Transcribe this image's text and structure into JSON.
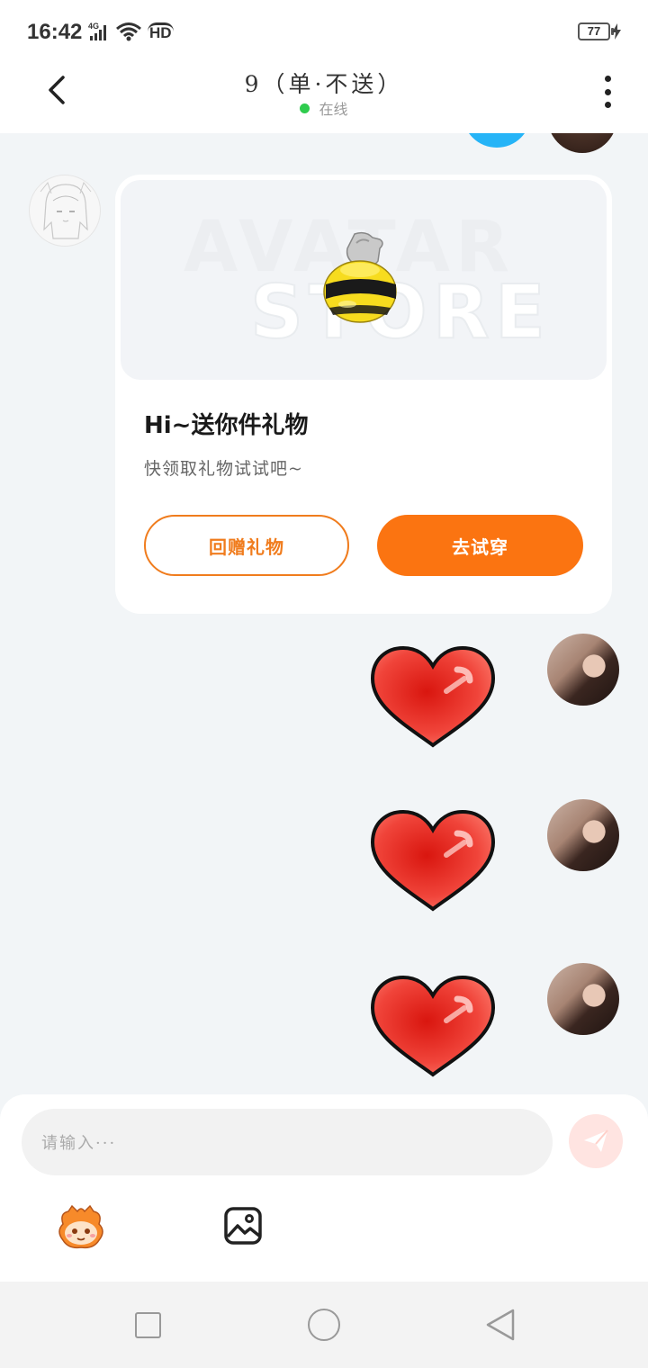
{
  "status_bar": {
    "time": "16:42",
    "network": "4G",
    "hd": "HD",
    "battery": "77",
    "icons": [
      "signal-icon",
      "wifi-icon",
      "hd-icon",
      "battery-icon",
      "charging-icon"
    ]
  },
  "header": {
    "title": "9（单·不送）",
    "status": "在线",
    "status_color": "#2fcc4e",
    "icons": [
      "back-arrow-icon",
      "more-options-icon"
    ]
  },
  "gift_card": {
    "watermark_line1": "AVATAR",
    "watermark_line2": "STORE",
    "title": "Hi~送你件礼物",
    "subtitle": "快领取礼物试试吧~",
    "return_gift_label": "回赠礼物",
    "try_on_label": "去试穿",
    "accent_color": "#fb7411"
  },
  "messages": [
    {
      "type": "sticker",
      "sticker": "red-heart",
      "sender": "me"
    },
    {
      "type": "sticker",
      "sticker": "red-heart",
      "sender": "me"
    },
    {
      "type": "sticker",
      "sticker": "red-heart",
      "sender": "me"
    }
  ],
  "composer": {
    "placeholder": "请输入···",
    "icons": [
      "send-icon",
      "emoji-icon",
      "image-icon"
    ]
  },
  "nav_bar": {
    "icons": [
      "recent-apps-icon",
      "home-icon",
      "back-icon"
    ]
  }
}
